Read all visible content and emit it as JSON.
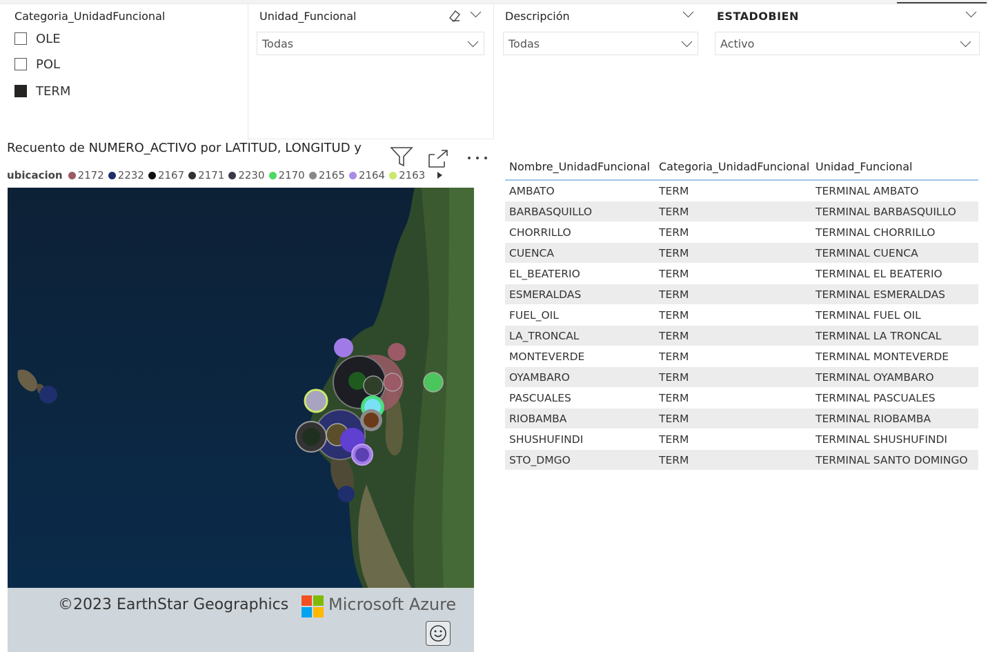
{
  "slicer_categoria": {
    "title": "Categoria_UnidadFuncional",
    "options": [
      {
        "label": "OLE",
        "checked": false
      },
      {
        "label": "POL",
        "checked": false
      },
      {
        "label": "TERM",
        "checked": true
      }
    ]
  },
  "slicer_unidad": {
    "title": "Unidad_Funcional",
    "value": "Todas"
  },
  "slicer_descripcion": {
    "title": "Descripción",
    "value": "Todas"
  },
  "slicer_estado": {
    "title": "ESTADOBIEN",
    "value": "Activo"
  },
  "map_visual": {
    "title": "Recuento de NUMERO_ACTIVO por LATITUD, LONGITUD y",
    "legend_title": "ubicacion",
    "legend": [
      {
        "label": "2172",
        "color": "#9b5a66"
      },
      {
        "label": "2232",
        "color": "#1f2f6e"
      },
      {
        "label": "2167",
        "color": "#111111"
      },
      {
        "label": "2171",
        "color": "#333333"
      },
      {
        "label": "2230",
        "color": "#3a3a4a"
      },
      {
        "label": "2170",
        "color": "#4cd964"
      },
      {
        "label": "2165",
        "color": "#888888"
      },
      {
        "label": "2164",
        "color": "#a98ce6"
      },
      {
        "label": "2163",
        "color": "#cbe86b"
      }
    ],
    "copyright": "©2023 EarthStar Geographics",
    "provider": "Microsoft Azure"
  },
  "table": {
    "headers": [
      "Nombre_UnidadFuncional",
      "Categoria_UnidadFuncional",
      "Unidad_Funcional"
    ],
    "rows": [
      [
        "AMBATO",
        "TERM",
        "TERMINAL AMBATO"
      ],
      [
        "BARBASQUILLO",
        "TERM",
        "TERMINAL BARBASQUILLO"
      ],
      [
        "CHORRILLO",
        "TERM",
        "TERMINAL CHORRILLO"
      ],
      [
        "CUENCA",
        "TERM",
        "TERMINAL CUENCA"
      ],
      [
        "EL_BEATERIO",
        "TERM",
        "TERMINAL EL BEATERIO"
      ],
      [
        "ESMERALDAS",
        "TERM",
        "TERMINAL ESMERALDAS"
      ],
      [
        "FUEL_OIL",
        "TERM",
        "TERMINAL FUEL OIL"
      ],
      [
        "LA_TRONCAL",
        "TERM",
        "TERMINAL LA TRONCAL"
      ],
      [
        "MONTEVERDE",
        "TERM",
        "TERMINAL MONTEVERDE"
      ],
      [
        "OYAMBARO",
        "TERM",
        "TERMINAL OYAMBARO"
      ],
      [
        "PASCUALES",
        "TERM",
        "TERMINAL PASCUALES"
      ],
      [
        "RIOBAMBA",
        "TERM",
        "TERMINAL RIOBAMBA"
      ],
      [
        "SHUSHUFINDI",
        "TERM",
        "TERMINAL SHUSHUFINDI"
      ],
      [
        "STO_DMGO",
        "TERM",
        "TERMINAL SANTO DOMINGO"
      ]
    ]
  }
}
